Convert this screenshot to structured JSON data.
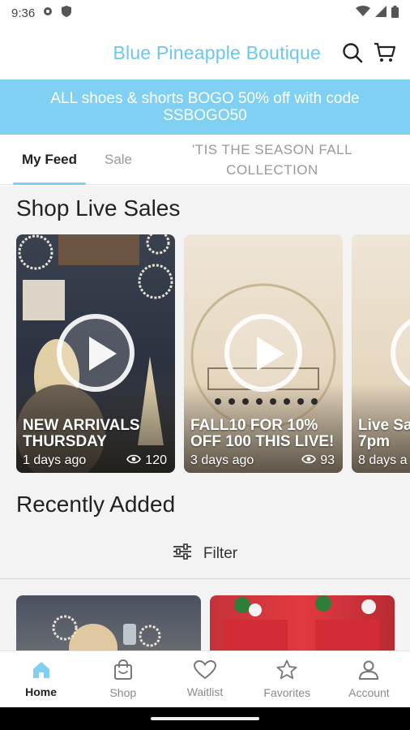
{
  "status_bar": {
    "time": "9:36"
  },
  "header": {
    "brand": "Blue Pineapple Boutique",
    "search_icon": "search-icon",
    "cart_icon": "cart-icon"
  },
  "promo": {
    "line1": "ALL shoes & shorts BOGO 50% off with code",
    "line2": "SSBOGO50"
  },
  "tabs": [
    {
      "label": "My Feed"
    },
    {
      "label": "Sale"
    },
    {
      "label_line1": "'TIS THE SEASON FALL",
      "label_line2": "COLLECTION"
    }
  ],
  "live_sales": {
    "title": "Shop Live Sales",
    "cards": [
      {
        "title": "NEW ARRIVALS THURSDAY",
        "age": "1 days ago",
        "views": "120"
      },
      {
        "title": "FALL10 FOR 10% OFF 100 THIS LIVE!",
        "age": "3 days ago",
        "views": "93"
      },
      {
        "title": "Live Sa 7pm",
        "age": "8 days a"
      }
    ]
  },
  "recent": {
    "title": "Recently Added",
    "filter_label": "Filter"
  },
  "bottom_nav": [
    {
      "label": "Home",
      "icon": "home-icon"
    },
    {
      "label": "Shop",
      "icon": "bag-icon"
    },
    {
      "label": "Waitlist",
      "icon": "heart-icon"
    },
    {
      "label": "Favorites",
      "icon": "star-icon"
    },
    {
      "label": "Account",
      "icon": "person-icon"
    }
  ],
  "colors": {
    "accent": "#7fd0f2",
    "brand_text": "#6cc6ee"
  }
}
